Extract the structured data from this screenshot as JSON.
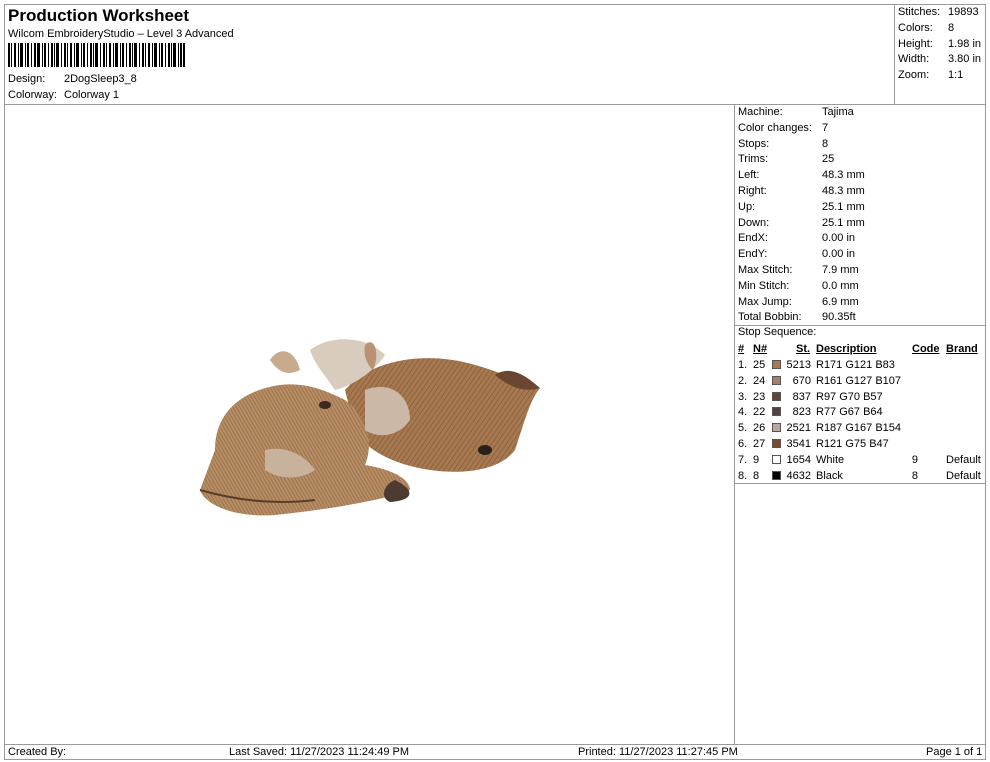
{
  "header": {
    "title": "Production Worksheet",
    "software": "Wilcom EmbroideryStudio – Level 3 Advanced",
    "design_label": "Design:",
    "design_value": "2DogSleep3_8",
    "colorway_label": "Colorway:",
    "colorway_value": "Colorway 1"
  },
  "stats": [
    {
      "label": "Stitches:",
      "value": "19893"
    },
    {
      "label": "Colors:",
      "value": "8"
    },
    {
      "label": "Height:",
      "value": "1.98 in"
    },
    {
      "label": "Width:",
      "value": "3.80 in"
    },
    {
      "label": "Zoom:",
      "value": "1:1"
    }
  ],
  "info": [
    {
      "label": "Machine:",
      "value": "Tajima"
    },
    {
      "label": "Color changes:",
      "value": "7"
    },
    {
      "label": "Stops:",
      "value": "8"
    },
    {
      "label": "Trims:",
      "value": "25"
    },
    {
      "label": "Left:",
      "value": "48.3 mm"
    },
    {
      "label": "Right:",
      "value": "48.3 mm"
    },
    {
      "label": "Up:",
      "value": "25.1 mm"
    },
    {
      "label": "Down:",
      "value": "25.1 mm"
    },
    {
      "label": "EndX:",
      "value": "0.00 in"
    },
    {
      "label": "EndY:",
      "value": "0.00 in"
    },
    {
      "label": "Max Stitch:",
      "value": "7.9 mm"
    },
    {
      "label": "Min Stitch:",
      "value": "0.0 mm"
    },
    {
      "label": "Max Jump:",
      "value": "6.9 mm"
    },
    {
      "label": "Total Bobbin:",
      "value": "90.35ft"
    }
  ],
  "stop_sequence": {
    "title": "Stop Sequence:",
    "columns": {
      "num": "#",
      "n": "N#",
      "st": "St.",
      "desc": "Description",
      "code": "Code",
      "brand": "Brand"
    },
    "rows": [
      {
        "num": "1.",
        "n": "25",
        "color": "#AB7953",
        "st": "5213",
        "desc": "R171 G121 B83",
        "code": "",
        "brand": ""
      },
      {
        "num": "2.",
        "n": "24",
        "color": "#A17F6B",
        "st": "670",
        "desc": "R161 G127 B107",
        "code": "",
        "brand": ""
      },
      {
        "num": "3.",
        "n": "23",
        "color": "#614639",
        "st": "837",
        "desc": "R97 G70 B57",
        "code": "",
        "brand": ""
      },
      {
        "num": "4.",
        "n": "22",
        "color": "#4D4340",
        "st": "823",
        "desc": "R77 G67 B64",
        "code": "",
        "brand": ""
      },
      {
        "num": "5.",
        "n": "26",
        "color": "#BBA79A",
        "st": "2521",
        "desc": "R187 G167 B154",
        "code": "",
        "brand": ""
      },
      {
        "num": "6.",
        "n": "27",
        "color": "#794B2F",
        "st": "3541",
        "desc": "R121 G75 B47",
        "code": "",
        "brand": ""
      },
      {
        "num": "7.",
        "n": "9",
        "color": "#FFFFFF",
        "st": "1654",
        "desc": "White",
        "code": "9",
        "brand": "Default"
      },
      {
        "num": "8.",
        "n": "8",
        "color": "#000000",
        "st": "4632",
        "desc": "Black",
        "code": "8",
        "brand": "Default"
      }
    ]
  },
  "footer": {
    "created_by": "Created By:",
    "last_saved": "Last Saved: 11/27/2023 11:24:49 PM",
    "printed": "Printed: 11/27/2023 11:27:45 PM",
    "page": "Page 1 of 1"
  }
}
